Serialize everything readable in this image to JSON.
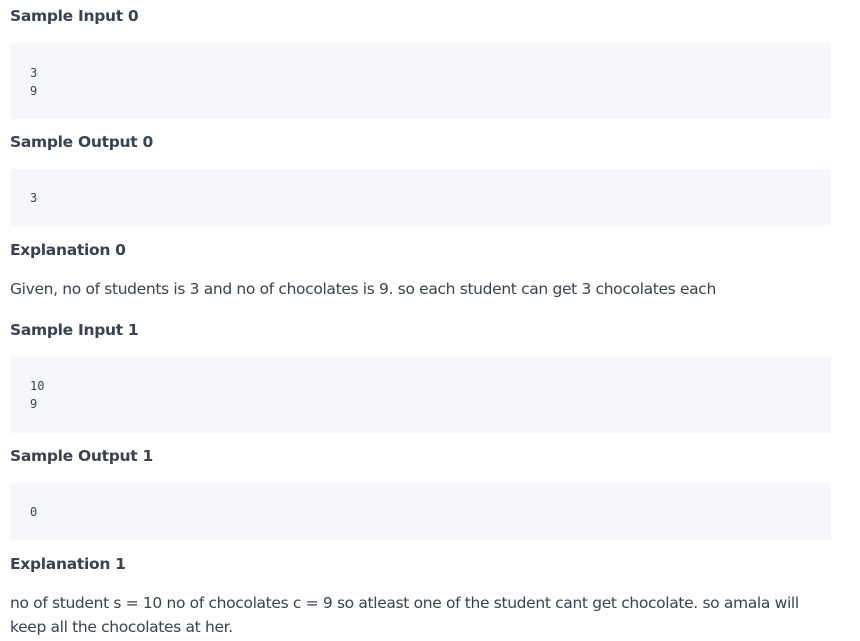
{
  "samples": [
    {
      "input_heading": "Sample Input 0",
      "input_lines": [
        "3",
        "9"
      ],
      "output_heading": "Sample Output 0",
      "output_lines": [
        "3"
      ],
      "explanation_heading": "Explanation 0",
      "explanation_text": "Given, no of students is 3 and no of chocolates is 9. so each student can get 3 chocolates each"
    },
    {
      "input_heading": "Sample Input 1",
      "input_lines": [
        "10",
        "9"
      ],
      "output_heading": "Sample Output 1",
      "output_lines": [
        "0"
      ],
      "explanation_heading": "Explanation 1",
      "explanation_text": "no of student s = 10 no of chocolates c = 9 so atleast one of the student cant get chocolate. so amala will keep all the chocolates at her."
    }
  ]
}
